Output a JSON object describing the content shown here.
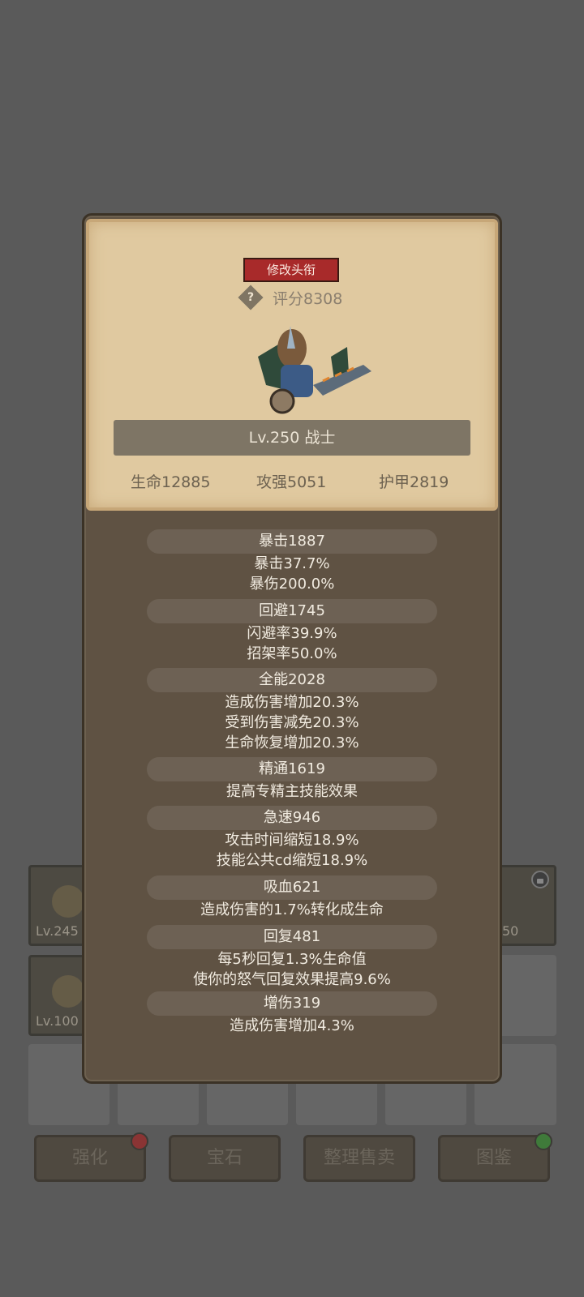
{
  "header": {
    "rename_title_label": "修改头衔",
    "score_label": "评分8308",
    "level_class": "Lv.250 战士",
    "stats": [
      "生命12885",
      "攻强5051",
      "护甲2819"
    ]
  },
  "attributes": [
    {
      "title": "暴击1887",
      "lines": [
        "暴击37.7%",
        "暴伤200.0%"
      ]
    },
    {
      "title": "回避1745",
      "lines": [
        "闪避率39.9%",
        "招架率50.0%"
      ]
    },
    {
      "title": "全能2028",
      "lines": [
        "造成伤害增加20.3%",
        "受到伤害减免20.3%",
        "生命恢复增加20.3%"
      ]
    },
    {
      "title": "精通1619",
      "lines": [
        "提高专精主技能效果"
      ]
    },
    {
      "title": "急速946",
      "lines": [
        "攻击时间缩短18.9%",
        "技能公共cd缩短18.9%"
      ]
    },
    {
      "title": "吸血621",
      "lines": [
        "造成伤害的1.7%转化成生命"
      ]
    },
    {
      "title": "回复481",
      "lines": [
        "每5秒回复1.3%生命值",
        "使你的怒气回复效果提高9.6%"
      ]
    },
    {
      "title": "增伤319",
      "lines": [
        "造成伤害增加4.3%"
      ]
    }
  ],
  "background": {
    "slot_levels": [
      "Lv.245",
      "Lv.100",
      "50"
    ],
    "buttons": [
      "强化",
      "宝石",
      "整理售卖",
      "图鉴"
    ]
  },
  "colors": {
    "title_button": "#a82a2a",
    "card": "#e0c9a0",
    "dialog": "#5f5243"
  }
}
